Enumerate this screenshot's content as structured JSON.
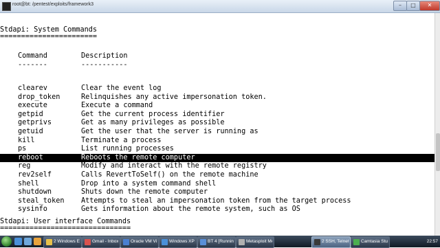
{
  "window": {
    "title": "root@bt: /pentest/exploits/framework3"
  },
  "terminal": {
    "section_title": "Stdapi: System Commands",
    "section_rule": "=======================",
    "col_command": "Command",
    "col_description": "Description",
    "col_command_rule": "-------",
    "col_description_rule": "-----------",
    "rows": [
      {
        "command": "clearev",
        "description": "Clear the event log"
      },
      {
        "command": "drop_token",
        "description": "Relinquishes any active impersonation token."
      },
      {
        "command": "execute",
        "description": "Execute a command"
      },
      {
        "command": "getpid",
        "description": "Get the current process identifier"
      },
      {
        "command": "getprivs",
        "description": "Get as many privileges as possible"
      },
      {
        "command": "getuid",
        "description": "Get the user that the server is running as"
      },
      {
        "command": "kill",
        "description": "Terminate a process"
      },
      {
        "command": "ps",
        "description": "List running processes"
      },
      {
        "command": "reboot",
        "description": "Reboots the remote computer"
      },
      {
        "command": "reg",
        "description": "Modify and interact with the remote registry"
      },
      {
        "command": "rev2self",
        "description": "Calls RevertToSelf() on the remote machine"
      },
      {
        "command": "shell",
        "description": "Drop into a system command shell"
      },
      {
        "command": "shutdown",
        "description": "Shuts down the remote computer"
      },
      {
        "command": "steal_token",
        "description": "Attempts to steal an impersonation token from the target process"
      },
      {
        "command": "sysinfo",
        "description": "Gets information about the remote system, such as OS"
      }
    ],
    "selected_row": "reboot",
    "section2_title": "Stdapi: User interface Commands",
    "section2_rule": "==============================="
  },
  "taskbar": {
    "items": [
      {
        "label": "2 Windows E...",
        "color": "#e8c14a"
      },
      {
        "label": "Gmail - Inbox (...",
        "color": "#d9534f"
      },
      {
        "label": "Oracle VM Virt...",
        "color": "#4a7fd1"
      },
      {
        "label": "Windows XP S...",
        "color": "#4a90d9"
      },
      {
        "label": "BT 4 [Running]...",
        "color": "#5a8fd8"
      },
      {
        "label": "Metasploit Me...",
        "color": "#b0b0b0"
      },
      {
        "label": "2 SSH, Telnet...",
        "color": "#3a3a3a"
      },
      {
        "label": "Camtasia Studi...",
        "color": "#4caf50"
      }
    ],
    "active_index": 6,
    "clock": "22:57"
  },
  "colors": {
    "selection_bg": "#000000",
    "selection_fg": "#ffffff"
  }
}
